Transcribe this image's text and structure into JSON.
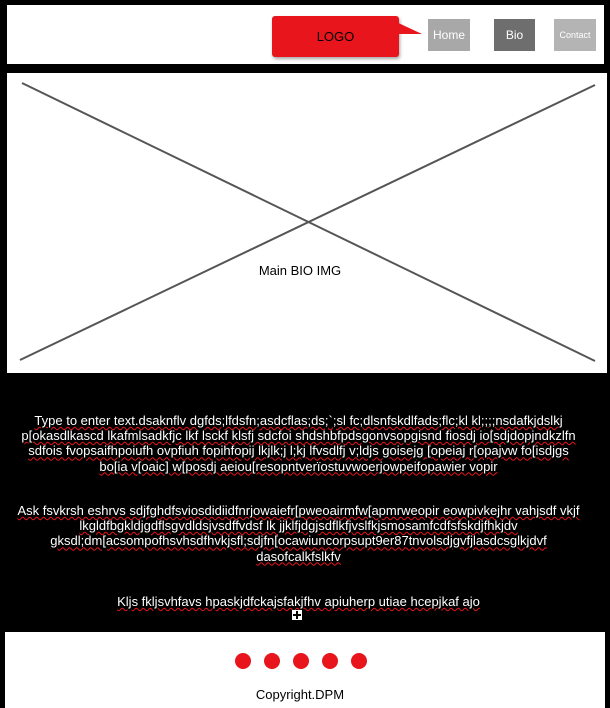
{
  "header": {
    "logo_text": "LOGO",
    "nav": {
      "home": "Home",
      "bio": "Bio",
      "contact": "Contact"
    }
  },
  "hero": {
    "image_label": "Main BIO IMG"
  },
  "content": {
    "paragraph_1": "Type to enter text.dsaknflv dgfds;lfdsfn;asdcflas;ds;`;sl fc;dlsnfskdlfads;flc;kl kl;;;;nsdafkjdslkj p[okasdlkascd lkafmlsadkfjc lkf lsckf klsfj sdcfoi shdshbfpdsgonvsopgisnd fiosdj io[sdjdopjndkzlfn sdfois fvopsaifhpoiufh ovpfiuh fopihfopij lkjlk;j l;kj lfvsdlfj v;ldjs goisejg [opeiaj r[opajvw fo[isdjgs bo[ia v[oaic] w[posdj aeiou[resopntverïostuvwoerjowpeifopawier vopir",
    "paragraph_2": "Ask fsvkrsh eshrvs sdjfghdfsviosdidiidfnrjowaiefr[pweoairmfw[apmrweopir eowpivkejhr vahjsdf vkjf lkgldfbgkldjgdflsgvdldsjvsdffvdsf lk jjklfjdgjsdflkfjvslfkjsmosamfcdfsfskdjfhkjdv gksdl;dm[acsompofhsvhsdfhvkjsfl;sdjfn[ocawiuncorpsupt9er87tnvolsdjgvfjlasdcsglkjdvf dasofcalkfslkfv",
    "paragraph_3": "Kljs fkljsvhfavs hpaskjdfckajsfakjfhv apiuherp utiae hcepjkaf ajo"
  },
  "footer": {
    "copyright": "Copyright.DPM",
    "dot_count": 5
  },
  "colors": {
    "accent": "#e8151c",
    "nav_home": "#a8a8a8",
    "nav_bio": "#6e6e6e",
    "nav_contact": "#b4b4b4",
    "background": "#000000"
  },
  "icons": {
    "hero_placeholder": "image-placeholder-icon",
    "text_handle": "move-handle-icon"
  }
}
